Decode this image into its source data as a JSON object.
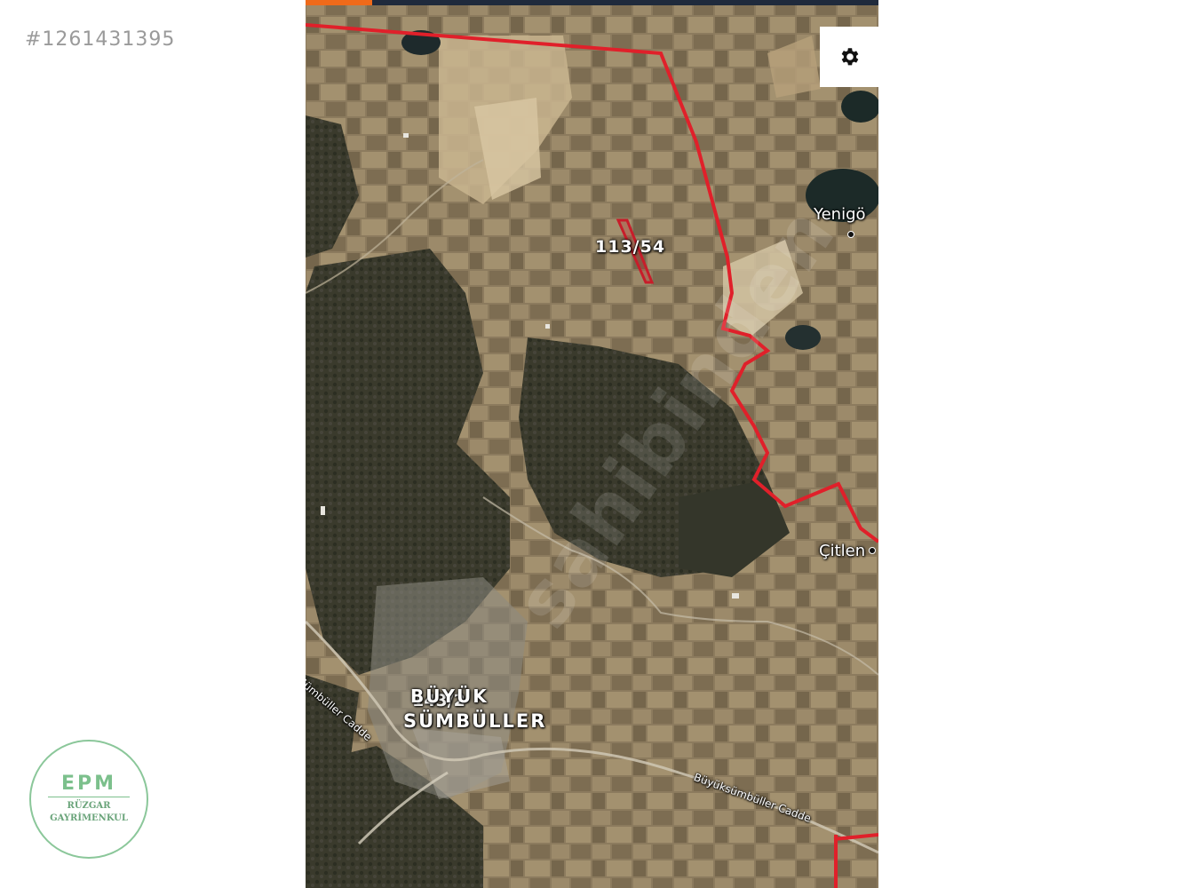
{
  "listing_id": "#1261431395",
  "map": {
    "parcel_label": "113/54",
    "second_parcel_label": "143/2",
    "village_line1": "BÜYÜK",
    "village_line2": "SÜMBÜLLER",
    "place_yenigol": "Yenigö",
    "place_citlen": "Çitlen",
    "road_left": "Sümbüller Cadde",
    "road_bottom": "Büyüksümbüller Cadde",
    "watermark": "sahibinden",
    "boundary_color": "#e0202a",
    "settings_icon": "gear-icon"
  },
  "logo": {
    "mark": "EPM",
    "line1": "RÜZGAR",
    "line2": "GAYRİMENKUL"
  }
}
